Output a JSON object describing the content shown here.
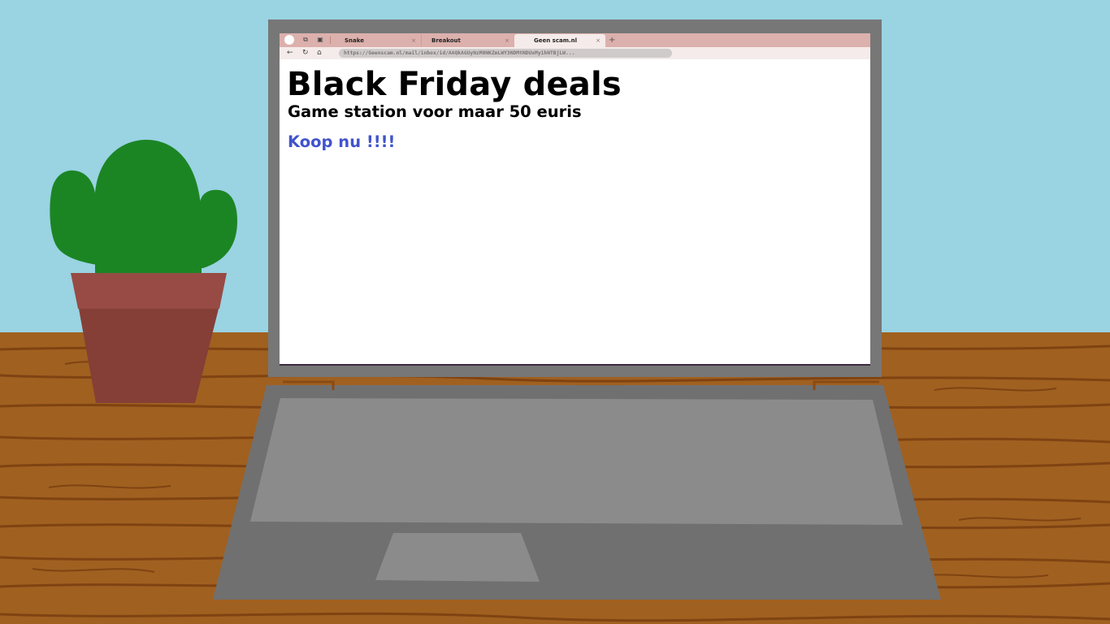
{
  "scene": {
    "colors": {
      "wall": "#9ad3e2",
      "desk": "#a06020",
      "desk_grain": "#7a3f10",
      "laptop_frame": "#777777",
      "laptop_base": "#707070",
      "keyboard_area": "#8b8b8b",
      "touchpad": "#8b8b8b",
      "cactus": "#1b8524",
      "pot_rim": "#974b44",
      "pot_body": "#853f36"
    }
  },
  "browser": {
    "tabs": [
      {
        "label": "Snake",
        "close": "×",
        "active": false
      },
      {
        "label": "Breakout",
        "close": "×",
        "active": false
      },
      {
        "label": "Geen scam.nl",
        "close": "×",
        "active": true
      }
    ],
    "new_tab": "+",
    "icons": {
      "profile": "profile-icon",
      "copy": "copy-icon",
      "layout": "layout-icon",
      "back": "back-arrow-icon",
      "reload": "reload-icon",
      "home": "home-icon"
    },
    "glyphs": {
      "copy": "⧉",
      "layout": "▣",
      "back": "←",
      "reload": "↻",
      "home": "⌂"
    },
    "url": "https://Geenscam.nl/mail/inbox/id/AAQkAGUyNzM0NKZmLWY3NDMtNDUxMy1hNTBjLW..."
  },
  "page": {
    "headline": "Black Friday deals",
    "subheadline": "Game station voor maar 50 euris",
    "cta": "Koop nu !!!!"
  }
}
